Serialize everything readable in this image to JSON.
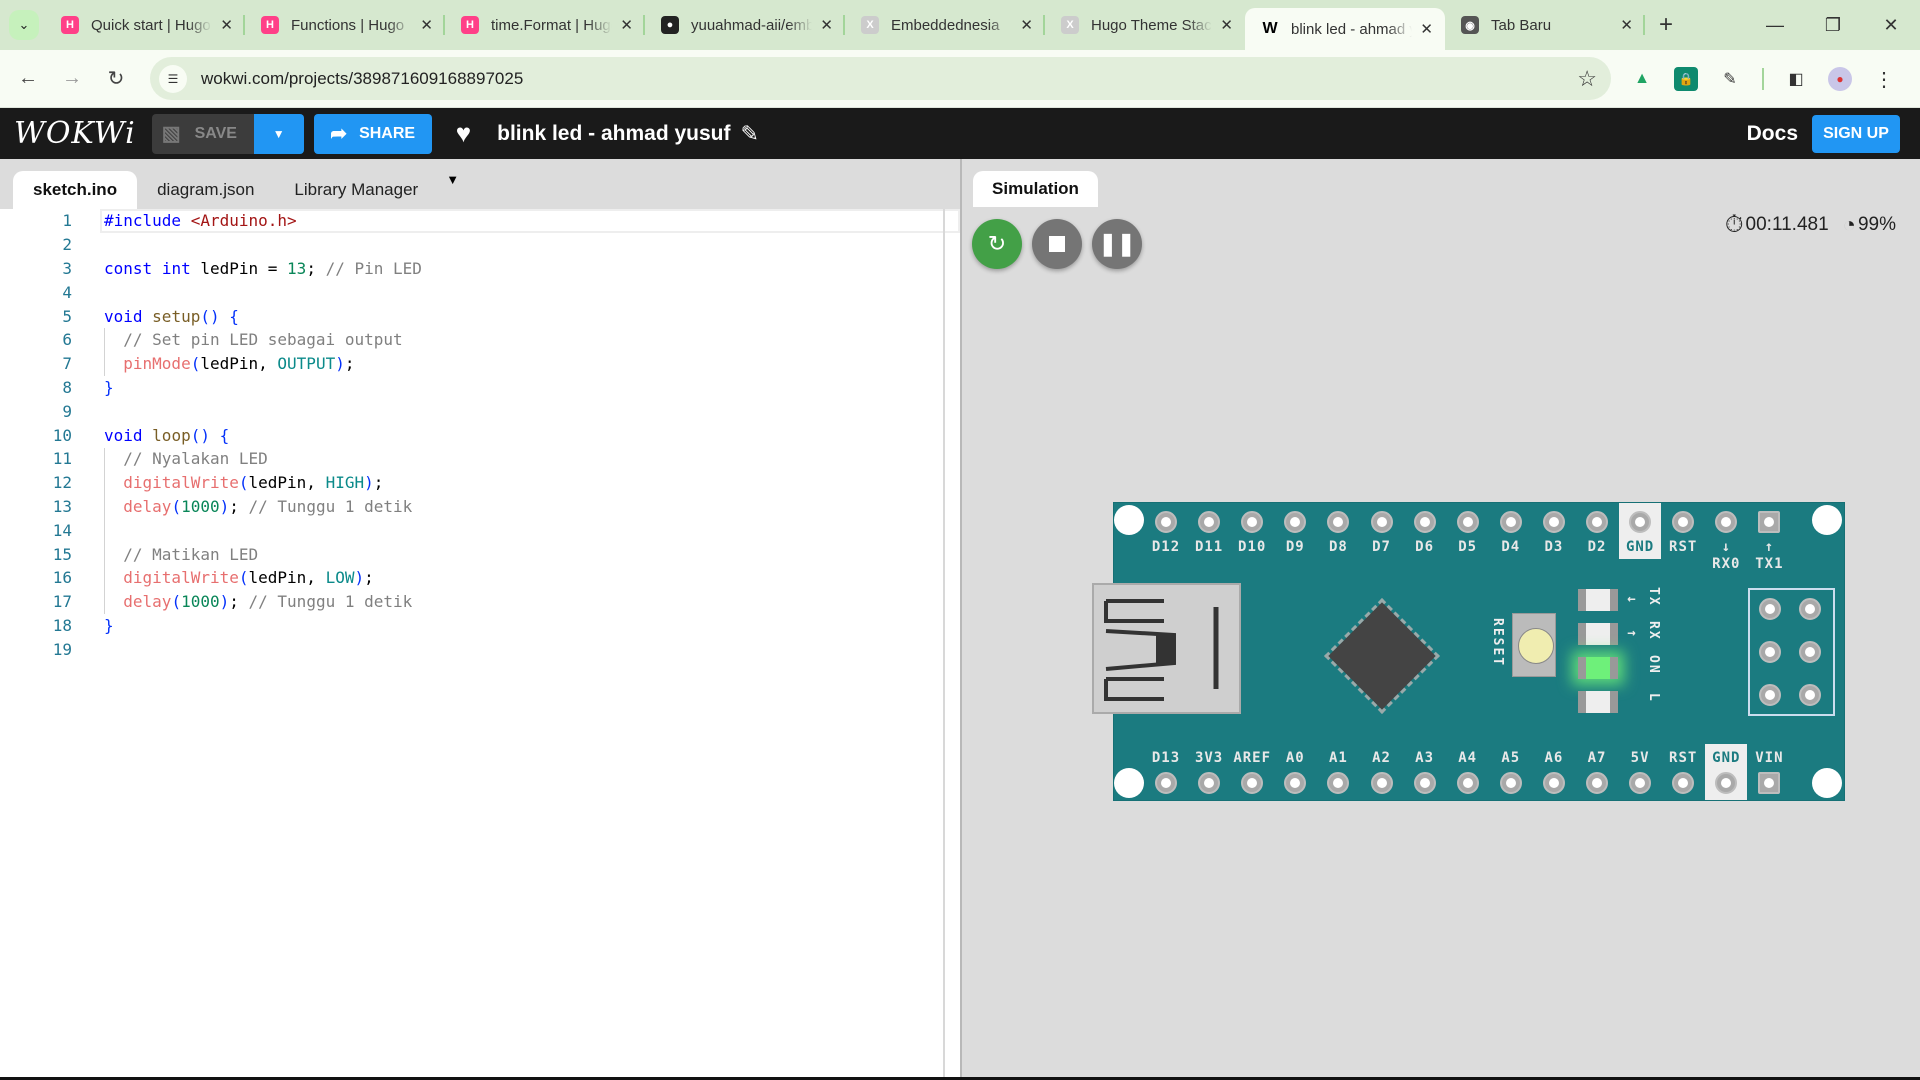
{
  "browser": {
    "tabs": [
      {
        "title": "Quick start | Hugo",
        "favicon": "hugo-icon",
        "color": "#ff4088"
      },
      {
        "title": "Functions | Hugo",
        "favicon": "hugo-icon",
        "color": "#ff4088"
      },
      {
        "title": "time.Format | Hugo",
        "favicon": "hugo-icon",
        "color": "#ff4088"
      },
      {
        "title": "yuuahmad-aii/embeddednesia",
        "favicon": "github-icon",
        "color": "#222222"
      },
      {
        "title": "Embeddednesia",
        "favicon": "x-icon",
        "color": "#cccccc"
      },
      {
        "title": "Hugo Theme Stack",
        "favicon": "x-icon",
        "color": "#cccccc"
      },
      {
        "title": "blink led - ahmad yusuf",
        "favicon": "wokwi-icon",
        "color": "#000000",
        "active": true
      },
      {
        "title": "Tab Baru",
        "favicon": "chrome-icon",
        "color": "#555555"
      }
    ],
    "url": "wokwi.com/projects/389871609168897025"
  },
  "header": {
    "logo": "WOKWi",
    "save_label": "SAVE",
    "share_label": "SHARE",
    "project_title": "blink led - ahmad yusuf",
    "docs_label": "Docs",
    "signup_label": "SIGN UP"
  },
  "editor": {
    "tabs": [
      "sketch.ino",
      "diagram.json",
      "Library Manager"
    ],
    "active_tab": "sketch.ino",
    "lines": [
      "#include <Arduino.h>",
      "",
      "const int ledPin = 13; // Pin LED",
      "",
      "void setup() {",
      "  // Set pin LED sebagai output",
      "  pinMode(ledPin, OUTPUT);",
      "}",
      "",
      "void loop() {",
      "  // Nyalakan LED",
      "  digitalWrite(ledPin, HIGH);",
      "  delay(1000); // Tunggu 1 detik",
      "",
      "  // Matikan LED",
      "  digitalWrite(ledPin, LOW);",
      "  delay(1000); // Tunggu 1 detik",
      "}",
      ""
    ]
  },
  "simulation": {
    "tab_label": "Simulation",
    "elapsed_time": "00:11.481",
    "speed": "99%",
    "board": {
      "name": "Arduino Nano",
      "top_pins": [
        "D12",
        "D11",
        "D10",
        "D9",
        "D8",
        "D7",
        "D6",
        "D5",
        "D4",
        "D3",
        "D2",
        "GND",
        "RST",
        "RX0",
        "TX1"
      ],
      "bottom_pins": [
        "D13",
        "3V3",
        "AREF",
        "A0",
        "A1",
        "A2",
        "A3",
        "A4",
        "A5",
        "A6",
        "A7",
        "5V",
        "RST",
        "GND",
        "VIN"
      ],
      "rx0_arrow": "↓",
      "tx1_arrow": "↑",
      "leds": [
        {
          "label": "TX",
          "arrow": "←",
          "on": false
        },
        {
          "label": "RX",
          "arrow": "→",
          "on": false
        },
        {
          "label": "ON",
          "arrow": "",
          "on": true
        },
        {
          "label": "L",
          "arrow": "",
          "on": false
        }
      ],
      "reset_label": "RESET"
    }
  }
}
